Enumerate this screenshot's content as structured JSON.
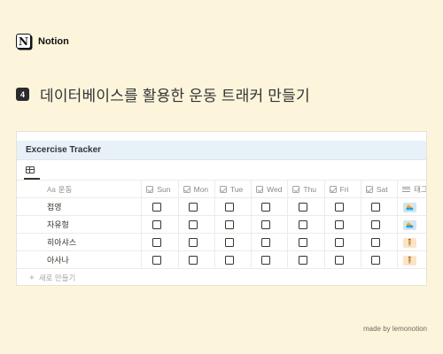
{
  "brand": {
    "name": "Notion",
    "logo_letter": "N"
  },
  "heading": {
    "step": "4",
    "title": "데이터베이스를 활용한 운동 트래커 만들기"
  },
  "database": {
    "title": "Excercise Tracker",
    "view_icon": "table-icon",
    "columns": {
      "name": {
        "icon_text": "Aa",
        "label": "운동"
      },
      "days": [
        "Sun",
        "Mon",
        "Tue",
        "Wed",
        "Thu",
        "Fri",
        "Sat"
      ],
      "tag": {
        "icon": "list-icon",
        "label": "태그"
      }
    },
    "rows": [
      {
        "name": "접영",
        "checks": [
          false,
          false,
          false,
          false,
          false,
          false,
          false
        ],
        "tag": {
          "icon": "swimming-icon",
          "glyph": "🏊",
          "bg": "#D3E5EF"
        }
      },
      {
        "name": "자유형",
        "checks": [
          false,
          false,
          false,
          false,
          false,
          false,
          false
        ],
        "tag": {
          "icon": "swimming-icon",
          "glyph": "🏊",
          "bg": "#D3E5EF"
        }
      },
      {
        "name": "히아샤스",
        "checks": [
          false,
          false,
          false,
          false,
          false,
          false,
          false
        ],
        "tag": {
          "icon": "person-icon",
          "glyph": "🧍",
          "bg": "#FBE4C7"
        }
      },
      {
        "name": "아사나",
        "checks": [
          false,
          false,
          false,
          false,
          false,
          false,
          false
        ],
        "tag": {
          "icon": "person-icon",
          "glyph": "🧍",
          "bg": "#FBE4C7"
        }
      }
    ],
    "new_row": {
      "icon": "plus-icon",
      "label": "새로 만들기"
    }
  },
  "footer": {
    "credit": "made by lemonotion"
  },
  "colors": {
    "background": "#FCF5DC",
    "title_bar": "#E7F1F7",
    "tag_blue": "#D3E5EF",
    "tag_orange": "#FBE4C7"
  }
}
